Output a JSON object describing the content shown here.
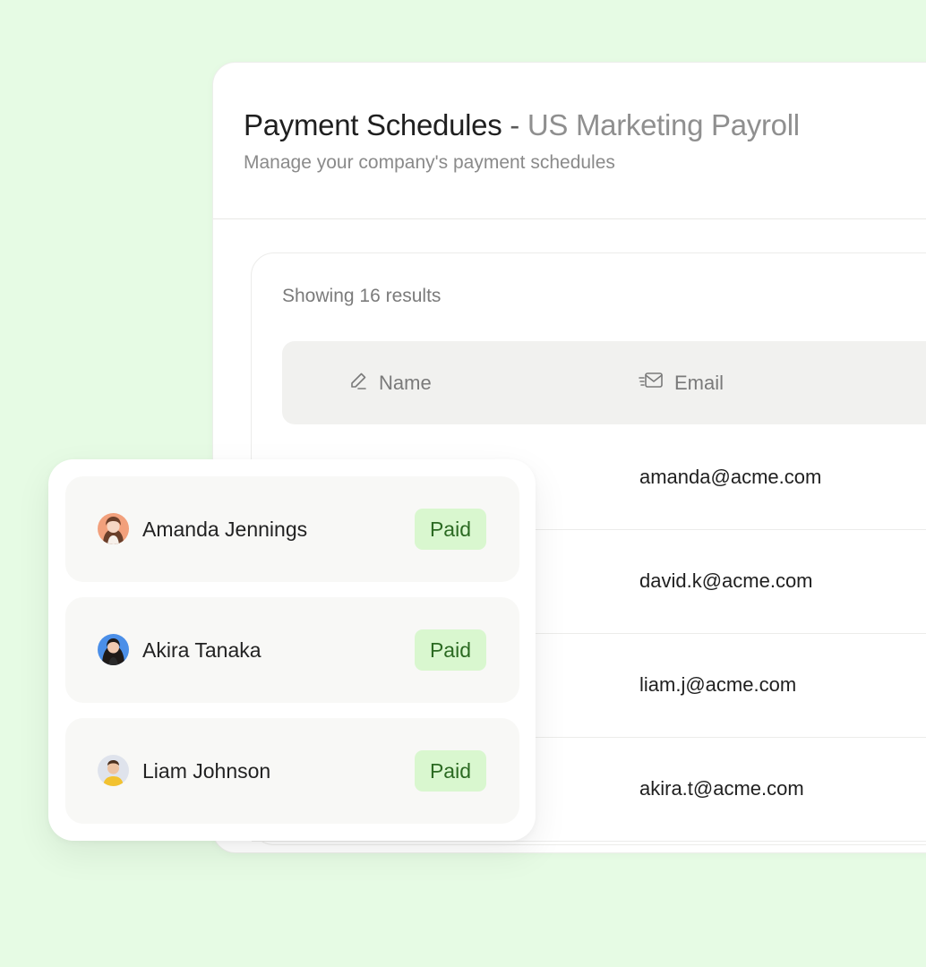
{
  "header": {
    "title_main": "Payment Schedules",
    "title_sep": "-",
    "title_sub": "US Marketing Payroll",
    "subtitle": "Manage your company's payment schedules"
  },
  "table": {
    "results_text": "Showing 16 results",
    "columns": [
      {
        "label": "Name",
        "icon": "pencil-icon"
      },
      {
        "label": "Email",
        "icon": "mail-icon"
      }
    ],
    "rows": [
      {
        "email": "amanda@acme.com"
      },
      {
        "email": "david.k@acme.com"
      },
      {
        "email": "liam.j@acme.com"
      },
      {
        "email": "akira.t@acme.com"
      }
    ]
  },
  "payments": [
    {
      "name": "Amanda Jennings",
      "status": "Paid",
      "avatar": "avatar-amanda"
    },
    {
      "name": "Akira Tanaka",
      "status": "Paid",
      "avatar": "avatar-akira"
    },
    {
      "name": "Liam Johnson",
      "status": "Paid",
      "avatar": "avatar-liam"
    }
  ],
  "colors": {
    "background": "#e6fbe4",
    "badge_bg": "#d9f7cf",
    "badge_text": "#2b6a22"
  }
}
